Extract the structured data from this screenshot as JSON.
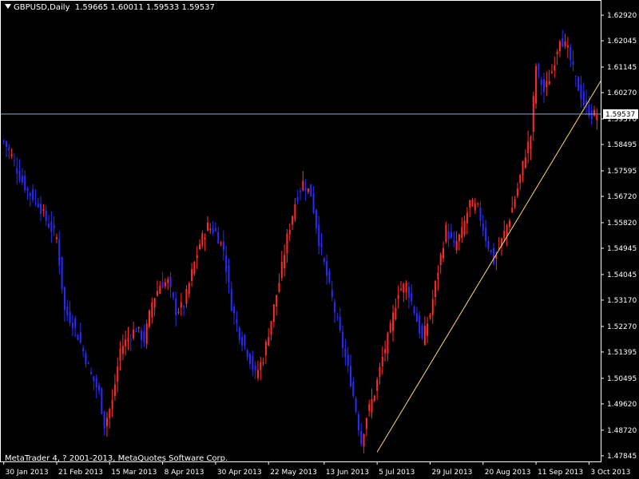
{
  "header": {
    "symbol": "GBPUSD,Daily",
    "ohlc": "1.59665 1.60011 1.59533 1.59537"
  },
  "copyright": "MetaTrader 4, ? 2001-2013, MetaQuotes Software Corp.",
  "colors": {
    "background": "#000000",
    "axis": "#ffffff",
    "bull": "#ff2a2a",
    "bear": "#2a2aff",
    "trendline": "#ffd966",
    "price_line": "#8aa8d8"
  },
  "chart_data": {
    "type": "candlestick",
    "symbol": "GBPUSD",
    "timeframe": "Daily",
    "ylim": [
      1.4765,
      1.6344
    ],
    "y_ticks": [
      "1.62920",
      "1.62045",
      "1.61145",
      "1.60270",
      "1.59370",
      "1.58495",
      "1.57595",
      "1.56720",
      "1.55820",
      "1.54945",
      "1.54045",
      "1.53170",
      "1.52270",
      "1.51395",
      "1.50495",
      "1.49620",
      "1.48720",
      "1.47845"
    ],
    "x_ticks": [
      "30 Jan 2013",
      "21 Feb 2013",
      "15 Mar 2013",
      "8 Apr 2013",
      "30 Apr 2013",
      "22 May 2013",
      "13 Jun 2013",
      "5 Jul 2013",
      "29 Jul 2013",
      "20 Aug 2013",
      "11 Sep 2013",
      "3 Oct 2013"
    ],
    "current_price": "1.59537",
    "close_path": [
      [
        0,
        1.586
      ],
      [
        3,
        1.581
      ],
      [
        6,
        1.574
      ],
      [
        9,
        1.569
      ],
      [
        13,
        1.565
      ],
      [
        16,
        1.559
      ],
      [
        20,
        1.553
      ],
      [
        23,
        1.528
      ],
      [
        26,
        1.524
      ],
      [
        29,
        1.517
      ],
      [
        33,
        1.506
      ],
      [
        36,
        1.5
      ],
      [
        38,
        1.489
      ],
      [
        41,
        1.497
      ],
      [
        44,
        1.515
      ],
      [
        47,
        1.519
      ],
      [
        50,
        1.522
      ],
      [
        53,
        1.518
      ],
      [
        56,
        1.531
      ],
      [
        59,
        1.537
      ],
      [
        62,
        1.538
      ],
      [
        65,
        1.528
      ],
      [
        68,
        1.53
      ],
      [
        71,
        1.541
      ],
      [
        74,
        1.551
      ],
      [
        77,
        1.557
      ],
      [
        80,
        1.555
      ],
      [
        83,
        1.549
      ],
      [
        86,
        1.53
      ],
      [
        89,
        1.52
      ],
      [
        92,
        1.514
      ],
      [
        95,
        1.506
      ],
      [
        98,
        1.512
      ],
      [
        101,
        1.525
      ],
      [
        104,
        1.538
      ],
      [
        107,
        1.553
      ],
      [
        110,
        1.565
      ],
      [
        113,
        1.572
      ],
      [
        116,
        1.568
      ],
      [
        119,
        1.552
      ],
      [
        122,
        1.54
      ],
      [
        125,
        1.528
      ],
      [
        128,
        1.516
      ],
      [
        131,
        1.504
      ],
      [
        133,
        1.494
      ],
      [
        135,
        1.483
      ],
      [
        137,
        1.492
      ],
      [
        140,
        1.5
      ],
      [
        143,
        1.512
      ],
      [
        146,
        1.522
      ],
      [
        149,
        1.535
      ],
      [
        152,
        1.537
      ],
      [
        155,
        1.528
      ],
      [
        158,
        1.518
      ],
      [
        161,
        1.527
      ],
      [
        164,
        1.542
      ],
      [
        167,
        1.556
      ],
      [
        170,
        1.55
      ],
      [
        173,
        1.555
      ],
      [
        176,
        1.565
      ],
      [
        179,
        1.563
      ],
      [
        182,
        1.553
      ],
      [
        185,
        1.545
      ],
      [
        188,
        1.552
      ],
      [
        191,
        1.56
      ],
      [
        194,
        1.57
      ],
      [
        197,
        1.582
      ],
      [
        199,
        1.588
      ],
      [
        201,
        1.612
      ],
      [
        204,
        1.603
      ],
      [
        207,
        1.61
      ],
      [
        210,
        1.622
      ],
      [
        213,
        1.617
      ],
      [
        216,
        1.607
      ],
      [
        219,
        1.599
      ],
      [
        222,
        1.595
      ],
      [
        224,
        1.5954
      ]
    ],
    "trendline": {
      "from": [
        "5 Jul 2013",
        1.4797
      ],
      "to": [
        "3 Oct 2013",
        1.6
      ]
    }
  }
}
